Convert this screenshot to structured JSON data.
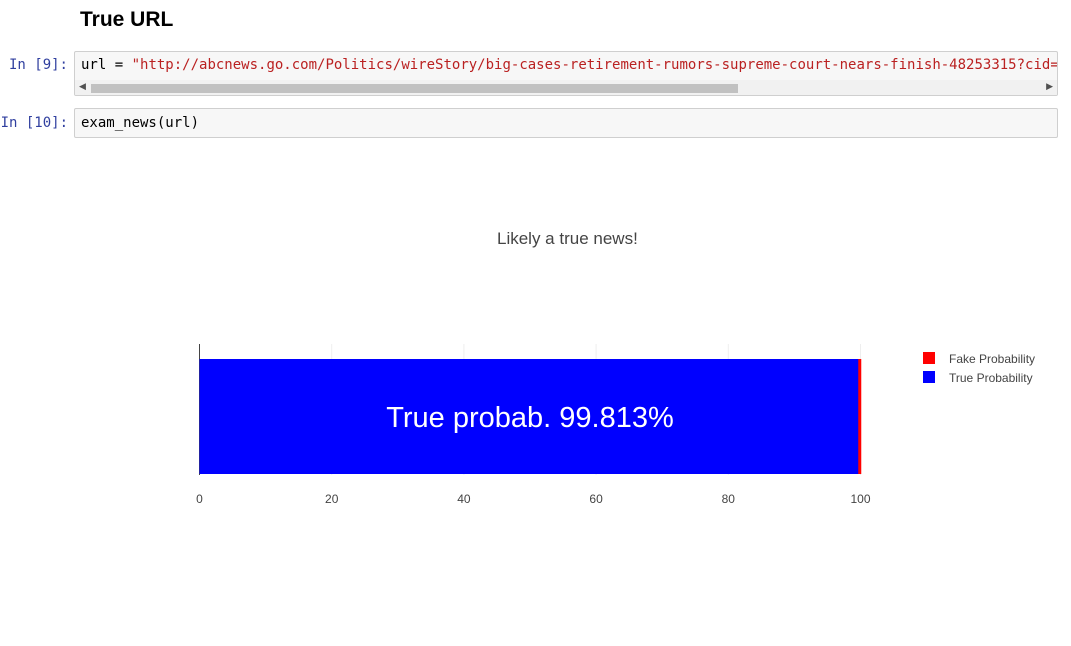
{
  "notebook": {
    "heading": "True URL",
    "cells": [
      {
        "prompt": "In [9]:",
        "code_var": "url",
        "code_op": " = ",
        "code_string": "\"http://abcnews.go.com/Politics/wireStory/big-cases-retirement-rumors-supreme-court-nears-finish-48253315?cid="
      },
      {
        "prompt": "In [10]:",
        "code": "exam_news(url)"
      }
    ]
  },
  "output": {
    "title": "Likely a true news!"
  },
  "chart_data": {
    "type": "bar",
    "orientation": "horizontal",
    "stacked": true,
    "series": [
      {
        "name": "True Probability",
        "values": [
          99.813
        ],
        "color": "#0000ff"
      },
      {
        "name": "Fake Probability",
        "values": [
          0.187
        ],
        "color": "#ff0000"
      }
    ],
    "annotation": "True probab. 99.813%",
    "xlim": [
      0,
      100
    ],
    "xticks": [
      "0",
      "20",
      "40",
      "60",
      "80",
      "100"
    ],
    "legend": [
      "Fake Probability",
      "True Probability"
    ],
    "legend_position": "right",
    "grid": true
  }
}
